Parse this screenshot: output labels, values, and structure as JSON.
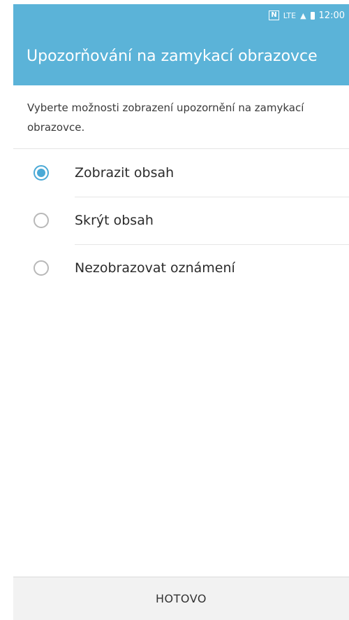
{
  "status_bar": {
    "nfc": "N",
    "network": "LTE",
    "time": "12:00"
  },
  "app_bar": {
    "title": "Upozorňování na zamykací obrazovce"
  },
  "description": "Vyberte možnosti zobrazení upozornění na zamykací obrazovce.",
  "options": [
    {
      "label": "Zobrazit obsah",
      "selected": true
    },
    {
      "label": "Skrýt obsah",
      "selected": false
    },
    {
      "label": "Nezobrazovat oznámení",
      "selected": false
    }
  ],
  "footer": {
    "done_label": "HOTOVO"
  },
  "colors": {
    "accent": "#5bb3d8",
    "radio_selected": "#4aa9d6"
  }
}
